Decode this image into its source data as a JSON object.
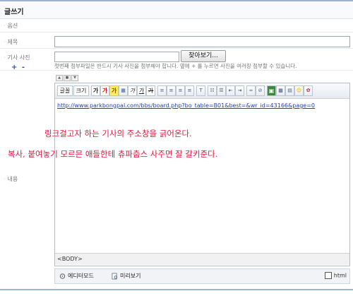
{
  "page": {
    "title": "글쓰기"
  },
  "form": {
    "option_label": "옵션",
    "subject_label": "제목",
    "photo_label": "기사 사진",
    "content_label": "내용",
    "subject_value": "",
    "file_button": "찾아보기...",
    "file_note": "첫번째 첨부파일은 반드시 기사 사진을 첨부해야 합니다. 옆에 + 를 누르면 사진을 여러장 첨부할 수 있습니다.",
    "add_symbol": "+",
    "remove_symbol": "-"
  },
  "editor": {
    "toolbar": {
      "font": "글꼴",
      "size": "크기",
      "bold": "가",
      "color": "가",
      "highlight": "가",
      "italic": "가",
      "underline": "가",
      "strike": "가"
    },
    "link_text": "http://www.parkbongpal.com/bbs/board.php?bo_table=B01&best=&wr_id=43166&page=0",
    "annotation_1": "링크걸고자 하는 기사의 주소창을 긁어온다.",
    "annotation_2": "복사, 붙여놓기 모르믄 애들한테 츄파춥스 사주면 잘 갈키준다.",
    "status_tag": "<BODY>"
  },
  "bottom_bar": {
    "editor_mode": "에디터모드",
    "preview": "미리보기",
    "html_label": "html",
    "html_checked": false
  },
  "colors": {
    "accent_line": "#9fb4cc",
    "annotation": "#e0163b",
    "link": "#1f3fb3"
  }
}
